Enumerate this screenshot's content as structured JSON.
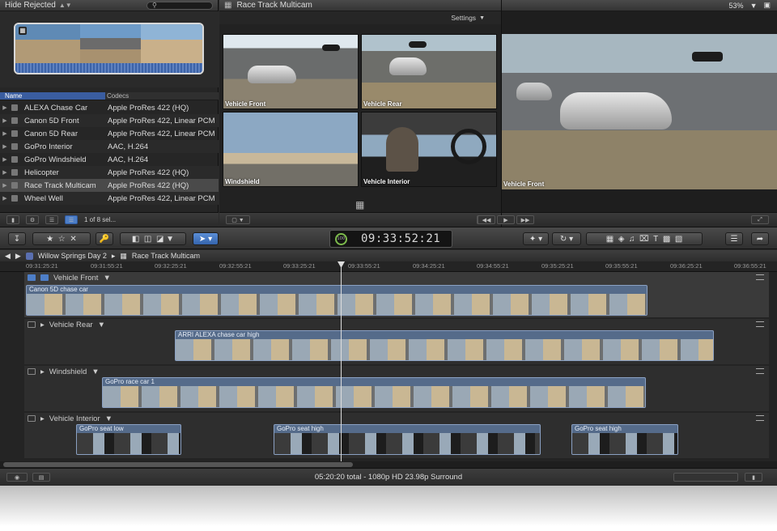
{
  "browser": {
    "filter": "Hide Rejected",
    "col_name": "Name",
    "col_codecs": "Codecs",
    "items": [
      {
        "name": "ALEXA Chase Car",
        "codec": "Apple ProRes 422 (HQ)"
      },
      {
        "name": "Canon 5D Front",
        "codec": "Apple ProRes 422, Linear PCM"
      },
      {
        "name": "Canon 5D Rear",
        "codec": "Apple ProRes 422, Linear PCM"
      },
      {
        "name": "GoPro Interior",
        "codec": "AAC, H.264"
      },
      {
        "name": "GoPro Windshield",
        "codec": "AAC, H.264"
      },
      {
        "name": "Helicopter",
        "codec": "Apple ProRes 422 (HQ)"
      },
      {
        "name": "Race Track Multicam",
        "codec": "Apple ProRes 422 (HQ)"
      },
      {
        "name": "Wheel Well",
        "codec": "Apple ProRes 422, Linear PCM"
      }
    ],
    "selection": "1 of 8 sel..."
  },
  "angle_viewer": {
    "title": "Race Track Multicam",
    "settings": "Settings",
    "angles": [
      "Vehicle Front",
      "Vehicle Rear",
      "Windshield",
      "Vehicle Interior"
    ]
  },
  "viewer": {
    "zoom": "53%",
    "active_angle": "Vehicle Front"
  },
  "timecode": {
    "value": "09:33:52:21",
    "percent": "100"
  },
  "timeline": {
    "project": "Willow Springs Day 2",
    "clip": "Race Track Multicam",
    "ruler": [
      "09:31:25:21",
      "09:31:55:21",
      "09:32:25:21",
      "09:32:55:21",
      "09:33:25:21",
      "09:33:55:21",
      "09:34:25:21",
      "09:34:55:21",
      "09:35:25:21",
      "09:35:55:21",
      "09:36:25:21",
      "09:36:55:21"
    ],
    "lanes": [
      {
        "name": "Vehicle Front",
        "clips": [
          "Canon 5D chase car"
        ]
      },
      {
        "name": "Vehicle Rear",
        "clips": [
          "ARRI ALEXA chase car high"
        ]
      },
      {
        "name": "Windshield",
        "clips": [
          "GoPro race car 1"
        ]
      },
      {
        "name": "Vehicle Interior",
        "clips": [
          "GoPro seat low",
          "GoPro seat high",
          "GoPro seat high"
        ]
      }
    ]
  },
  "status": "05:20:20 total - 1080p HD 23.98p Surround",
  "colors": {
    "accent": "#4d7ec7",
    "clip": "#556b8a"
  }
}
